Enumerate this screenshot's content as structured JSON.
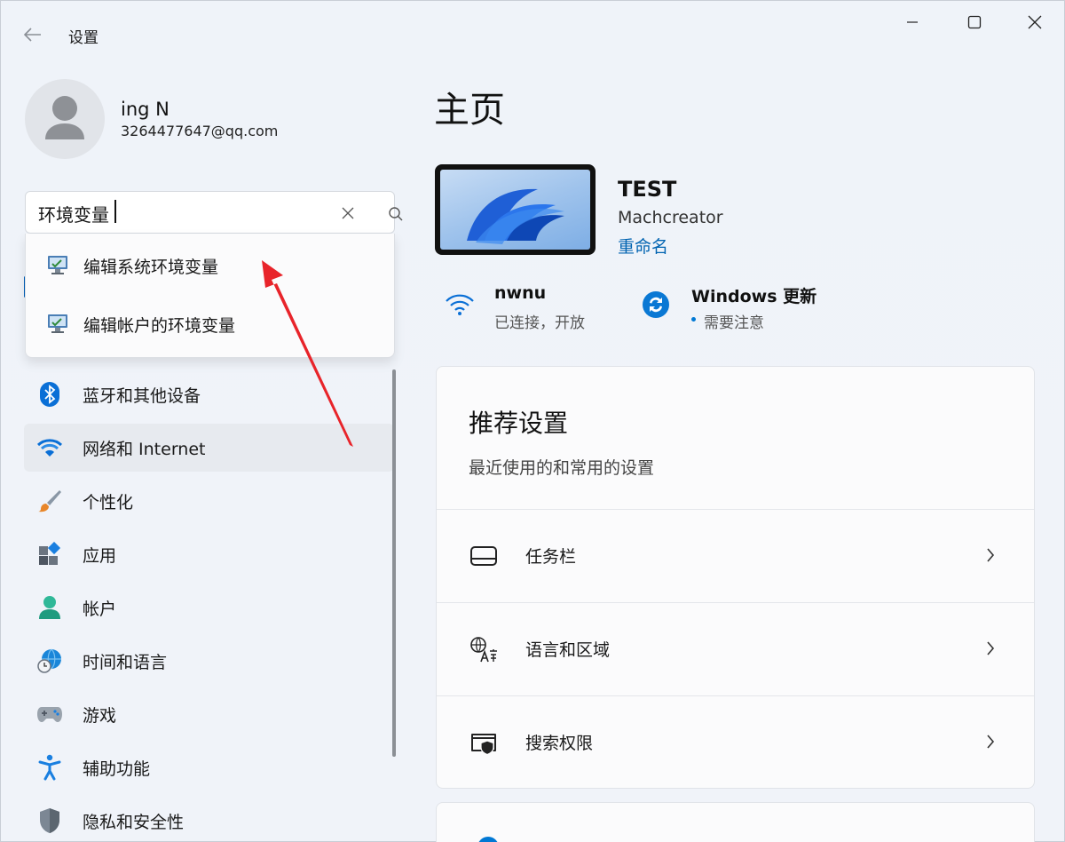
{
  "window": {
    "title": "设置"
  },
  "profile": {
    "name": "ing N",
    "email": "3264477647@qq.com"
  },
  "search": {
    "value": "环境变量",
    "results": [
      {
        "label": "编辑系统环境变量",
        "icon": "system-properties-icon"
      },
      {
        "label": "编辑帐户的环境变量",
        "icon": "system-properties-icon"
      }
    ]
  },
  "nav": {
    "items": [
      {
        "label": "蓝牙和其他设备",
        "icon": "bluetooth-icon"
      },
      {
        "label": "网络和 Internet",
        "icon": "wifi-icon",
        "active": true
      },
      {
        "label": "个性化",
        "icon": "brush-icon"
      },
      {
        "label": "应用",
        "icon": "apps-icon"
      },
      {
        "label": "帐户",
        "icon": "account-icon"
      },
      {
        "label": "时间和语言",
        "icon": "clock-globe-icon"
      },
      {
        "label": "游戏",
        "icon": "gamepad-icon"
      },
      {
        "label": "辅助功能",
        "icon": "accessibility-icon"
      },
      {
        "label": "隐私和安全性",
        "icon": "shield-icon"
      }
    ]
  },
  "main": {
    "title": "主页",
    "device": {
      "name": "TEST",
      "model": "Machcreator",
      "rename": "重命名"
    },
    "network": {
      "name": "nwnu",
      "status": "已连接，开放"
    },
    "update": {
      "title": "Windows 更新",
      "status": "需要注意"
    },
    "recommended": {
      "title": "推荐设置",
      "subtitle": "最近使用的和常用的设置",
      "items": [
        {
          "label": "任务栏",
          "icon": "taskbar-icon"
        },
        {
          "label": "语言和区域",
          "icon": "language-icon"
        },
        {
          "label": "搜索权限",
          "icon": "search-permissions-icon"
        }
      ]
    }
  },
  "colors": {
    "accent": "#0078d4",
    "annotation_arrow": "#e8242a"
  }
}
